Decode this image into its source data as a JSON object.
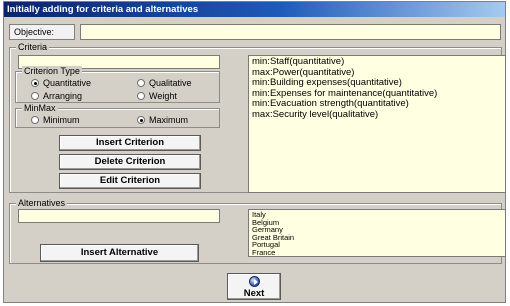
{
  "window": {
    "title": "Initially adding for criteria and alternatives"
  },
  "objective": {
    "label": "Objective:",
    "value": ""
  },
  "criteria": {
    "group_title": "Criteria",
    "input_value": "",
    "criterion_type": {
      "group_title": "Criterion Type",
      "options": [
        "Quantitative",
        "Qualitative",
        "Arranging",
        "Weight"
      ],
      "selected": "Quantitative"
    },
    "minmax": {
      "group_title": "MinMax",
      "options": [
        "Minimum",
        "Maximum"
      ],
      "selected": "Maximum"
    },
    "buttons": {
      "insert": "Insert Criterion",
      "delete": "Delete Criterion",
      "edit": "Edit Criterion"
    },
    "items": [
      "min:Staff(quantitative)",
      "max:Power(quantitative)",
      "min:Building expenses(quantitative)",
      "min:Expenses for maintenance(quantitative)",
      "min:Evacuation strength(quantitative)",
      "max:Security level(qualitative)"
    ]
  },
  "alternatives": {
    "group_title": "Alternatives",
    "input_value": "",
    "insert_button": "Insert Alternative",
    "items": [
      "Italy",
      "Belgium",
      "Germany",
      "Great Britain",
      "Portugal",
      "France"
    ]
  },
  "next_button": {
    "label": "Next",
    "icon": "next-arrow-icon"
  },
  "colors": {
    "title_bar": "#0a246a",
    "input_background": "#ffffe1",
    "window_background": "#d4d0c8"
  }
}
